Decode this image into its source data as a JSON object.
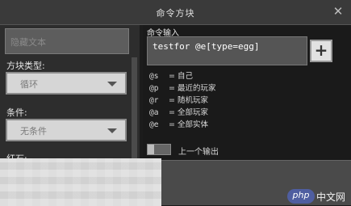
{
  "window": {
    "title": "命令方块",
    "close_glyph": "✕"
  },
  "left_panel": {
    "name_placeholder": "隐藏文本",
    "block_type_label": "方块类型:",
    "block_type_value": "循环",
    "condition_label": "条件:",
    "condition_value": "无条件",
    "redstone_label": "红石:"
  },
  "right_panel": {
    "command_label": "命令输入",
    "command_value": "testfor @e[type=egg]",
    "add_glyph": "+",
    "hints": [
      {
        "key": "@s",
        "desc": "= 自己"
      },
      {
        "key": "@p",
        "desc": "= 最近的玩家"
      },
      {
        "key": "@r",
        "desc": "= 随机玩家"
      },
      {
        "key": "@a",
        "desc": "= 全部玩家"
      },
      {
        "key": "@e",
        "desc": "= 全部实体"
      }
    ],
    "previous_output_label": "上一个输出"
  },
  "watermark": {
    "badge": "php",
    "text": "中文网"
  }
}
